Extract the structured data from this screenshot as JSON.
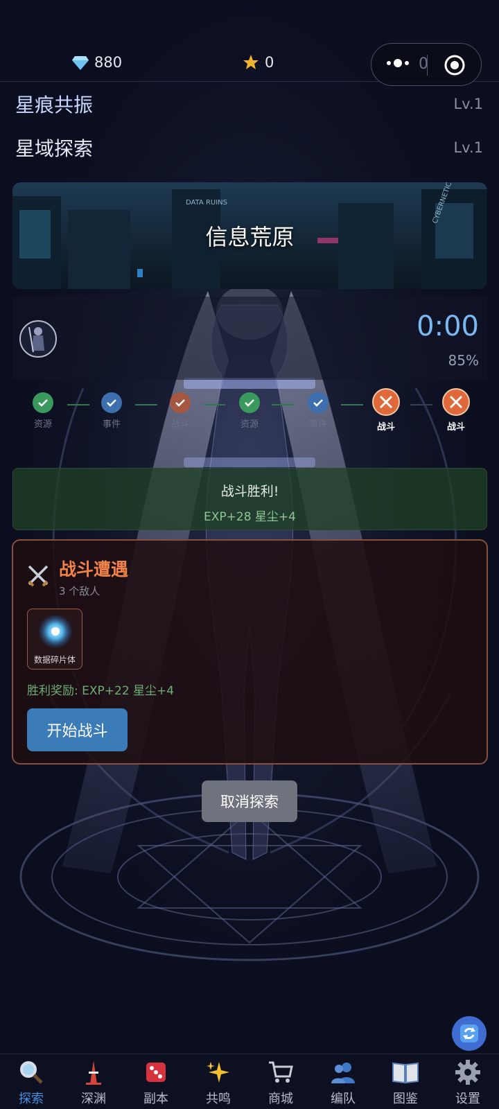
{
  "topbar": {
    "diamonds": "880",
    "stars": "0",
    "capsule_count": "0"
  },
  "levels": [
    {
      "name": "星痕共振",
      "lv": "Lv.1",
      "color": "#c9d6ff"
    },
    {
      "name": "星域探索",
      "lv": "Lv.1",
      "color": "#e8e9ee"
    }
  ],
  "banner": {
    "title": "信息荒原",
    "sign_left": "DATA RUINS",
    "sign_right": "CYBERNETICS"
  },
  "timer": {
    "value": "0:00",
    "percent": "85%"
  },
  "progress_nodes": [
    {
      "label": "资源",
      "state": "done",
      "color": "#3a9a5e"
    },
    {
      "label": "事件",
      "state": "done",
      "color": "#3d6fae"
    },
    {
      "label": "战斗",
      "state": "done",
      "color": "#a5583f"
    },
    {
      "label": "资源",
      "state": "done",
      "color": "#3a9a5e"
    },
    {
      "label": "事件",
      "state": "done",
      "color": "#3d6fae"
    },
    {
      "label": "战斗",
      "state": "current",
      "color": "#e0693c"
    },
    {
      "label": "战斗",
      "state": "upcoming",
      "color": "#e0693c"
    }
  ],
  "victory": {
    "title": "战斗胜利!",
    "rewards": "EXP+28   星尘+4"
  },
  "encounter": {
    "title": "战斗遭遇",
    "subtitle": "3 个敌人",
    "enemy_name": "数据碎片体",
    "reward_text": "胜利奖励: EXP+22   星尘+4",
    "start_label": "开始战斗"
  },
  "cancel_label": "取消探索",
  "nav": [
    {
      "label": "探索",
      "icon": "magnifier-icon",
      "active": true
    },
    {
      "label": "深渊",
      "icon": "tower-icon",
      "active": false
    },
    {
      "label": "副本",
      "icon": "dice-icon",
      "active": false
    },
    {
      "label": "共鸣",
      "icon": "sparkles-icon",
      "active": false
    },
    {
      "label": "商城",
      "icon": "cart-icon",
      "active": false
    },
    {
      "label": "编队",
      "icon": "team-icon",
      "active": false
    },
    {
      "label": "图鉴",
      "icon": "book-icon",
      "active": false
    },
    {
      "label": "设置",
      "icon": "gear-icon",
      "active": false
    }
  ],
  "colors": {
    "accent_blue": "#4b8fe0",
    "encounter_orange": "#f0824a",
    "victory_green": "#8fc494"
  }
}
